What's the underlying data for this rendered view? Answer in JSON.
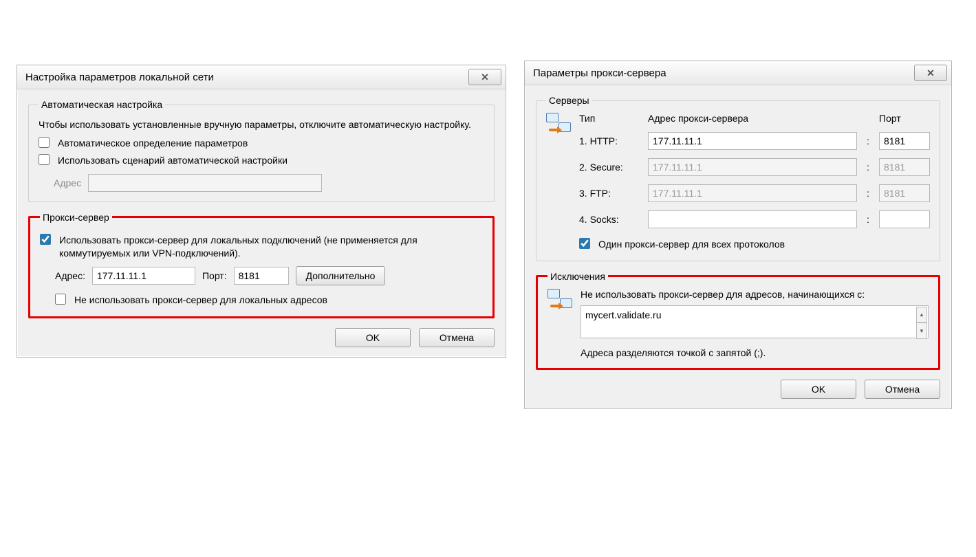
{
  "lan": {
    "title": "Настройка параметров локальной сети",
    "auto": {
      "legend": "Автоматическая настройка",
      "note": "Чтобы использовать установленные вручную параметры, отключите автоматическую настройку.",
      "auto_detect_label": "Автоматическое определение параметров",
      "auto_detect_checked": false,
      "script_label": "Использовать сценарий автоматической настройки",
      "script_checked": false,
      "address_label": "Адрес",
      "address_value": ""
    },
    "proxy": {
      "legend": "Прокси-сервер",
      "use_proxy_label": "Использовать прокси-сервер для локальных подключений (не применяется для коммутируемых или VPN-подключений).",
      "use_proxy_checked": true,
      "address_label": "Адрес:",
      "address_value": "177.11.11.1",
      "port_label": "Порт:",
      "port_value": "8181",
      "advanced_label": "Дополнительно",
      "bypass_local_label": "Не использовать прокси-сервер для локальных адресов",
      "bypass_local_checked": false
    },
    "ok": "OK",
    "cancel": "Отмена"
  },
  "adv": {
    "title": "Параметры прокси-сервера",
    "servers": {
      "legend": "Серверы",
      "col_type": "Тип",
      "col_addr": "Адрес прокси-сервера",
      "col_port": "Порт",
      "rows": [
        {
          "label": "1. HTTP:",
          "addr": "177.11.11.1",
          "port": "8181",
          "disabled": false
        },
        {
          "label": "2. Secure:",
          "addr": "177.11.11.1",
          "port": "8181",
          "disabled": true
        },
        {
          "label": "3. FTP:",
          "addr": "177.11.11.1",
          "port": "8181",
          "disabled": true
        },
        {
          "label": "4. Socks:",
          "addr": "",
          "port": "",
          "disabled": false
        }
      ],
      "same_label": "Один прокси-сервер для всех протоколов",
      "same_checked": true
    },
    "exceptions": {
      "legend": "Исключения",
      "note": "Не использовать прокси-сервер для адресов, начинающихся с:",
      "value": "mycert.validate.ru",
      "hint": "Адреса разделяются точкой с запятой (;)."
    },
    "ok": "OK",
    "cancel": "Отмена"
  }
}
